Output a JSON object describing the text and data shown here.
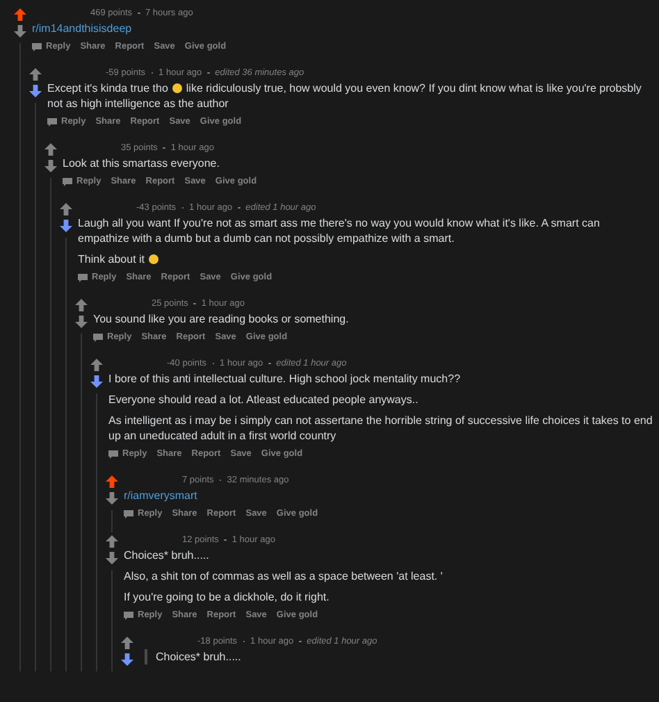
{
  "comments": [
    {
      "upvoted": true,
      "downvoted": false,
      "points": "469 points",
      "time": "7 hours ago",
      "body": [
        {
          "kind": "link",
          "text": "r/im14andthisisdeep"
        }
      ],
      "actions": [
        "Reply",
        "Share",
        "Report",
        "Save",
        "Give gold"
      ],
      "replies": [
        {
          "upvoted": false,
          "downvoted": true,
          "points": "-59 points",
          "time": "1 hour ago",
          "edited": "edited 36 minutes ago",
          "body": [
            {
              "kind": "text",
              "parts": [
                {
                  "kind": "text",
                  "text": "Except it's kinda true tho"
                },
                {
                  "kind": "emoji"
                },
                {
                  "kind": "text",
                  "text": "like ridiculously true, how would you even know? If you dint know what is like you're probsbly not as high intelligence as the author"
                }
              ]
            }
          ],
          "actions": [
            "Reply",
            "Share",
            "Report",
            "Save",
            "Give gold"
          ],
          "replies": [
            {
              "upvoted": false,
              "downvoted": false,
              "points": "35 points",
              "time": "1 hour ago",
              "body": [
                {
                  "kind": "text",
                  "text": "Look at this smartass everyone."
                }
              ],
              "actions": [
                "Reply",
                "Share",
                "Report",
                "Save",
                "Give gold"
              ],
              "replies": [
                {
                  "upvoted": false,
                  "downvoted": true,
                  "points": "-43 points",
                  "time": "1 hour ago",
                  "edited": "edited 1 hour ago",
                  "body": [
                    {
                      "kind": "text",
                      "text": "Laugh all you want If you're not as smart ass me there's no way you would know what it's like. A smart can empathize with a dumb but a dumb can not possibly empathize with a smart."
                    },
                    {
                      "kind": "text",
                      "parts": [
                        {
                          "kind": "text",
                          "text": "Think about it"
                        },
                        {
                          "kind": "emoji"
                        }
                      ]
                    }
                  ],
                  "actions": [
                    "Reply",
                    "Share",
                    "Report",
                    "Save",
                    "Give gold"
                  ],
                  "replies": [
                    {
                      "upvoted": false,
                      "downvoted": false,
                      "points": "25 points",
                      "time": "1 hour ago",
                      "body": [
                        {
                          "kind": "text",
                          "text": "You sound like you are reading books or something."
                        }
                      ],
                      "actions": [
                        "Reply",
                        "Share",
                        "Report",
                        "Save",
                        "Give gold"
                      ],
                      "replies": [
                        {
                          "upvoted": false,
                          "downvoted": true,
                          "points": "-40 points",
                          "time": "1 hour ago",
                          "edited": "edited 1 hour ago",
                          "body": [
                            {
                              "kind": "text",
                              "text": "I bore of this anti intellectual culture. High school jock mentality much??"
                            },
                            {
                              "kind": "text",
                              "text": "Everyone should read a lot. Atleast educated people anyways.."
                            },
                            {
                              "kind": "text",
                              "text": "As intelligent as i may be i simply can not assertane the horrible string of successive life choices it takes to end up an uneducated adult in a first world country"
                            }
                          ],
                          "actions": [
                            "Reply",
                            "Share",
                            "Report",
                            "Save",
                            "Give gold"
                          ],
                          "replies": [
                            {
                              "upvoted": true,
                              "downvoted": false,
                              "points": "7 points",
                              "time": "32 minutes ago",
                              "body": [
                                {
                                  "kind": "link",
                                  "text": "r/iamverysmart"
                                }
                              ],
                              "actions": [
                                "Reply",
                                "Share",
                                "Report",
                                "Save",
                                "Give gold"
                              ]
                            },
                            {
                              "upvoted": false,
                              "downvoted": false,
                              "points": "12 points",
                              "time": "1 hour ago",
                              "body": [
                                {
                                  "kind": "text",
                                  "text": "Choices* bruh....."
                                },
                                {
                                  "kind": "text",
                                  "text": "Also, a shit ton of commas as well as a space between 'at least. '"
                                },
                                {
                                  "kind": "text",
                                  "text": "If you're going to be a dickhole, do it right."
                                }
                              ],
                              "actions": [
                                "Reply",
                                "Share",
                                "Report",
                                "Save",
                                "Give gold"
                              ],
                              "replies": [
                                {
                                  "upvoted": false,
                                  "downvoted": true,
                                  "points": "-18 points",
                                  "time": "1 hour ago",
                                  "edited": "edited 1 hour ago",
                                  "body": [
                                    {
                                      "kind": "quote",
                                      "text": "Choices* bruh....."
                                    }
                                  ]
                                }
                              ]
                            }
                          ]
                        }
                      ]
                    }
                  ]
                }
              ]
            }
          ]
        }
      ]
    }
  ]
}
